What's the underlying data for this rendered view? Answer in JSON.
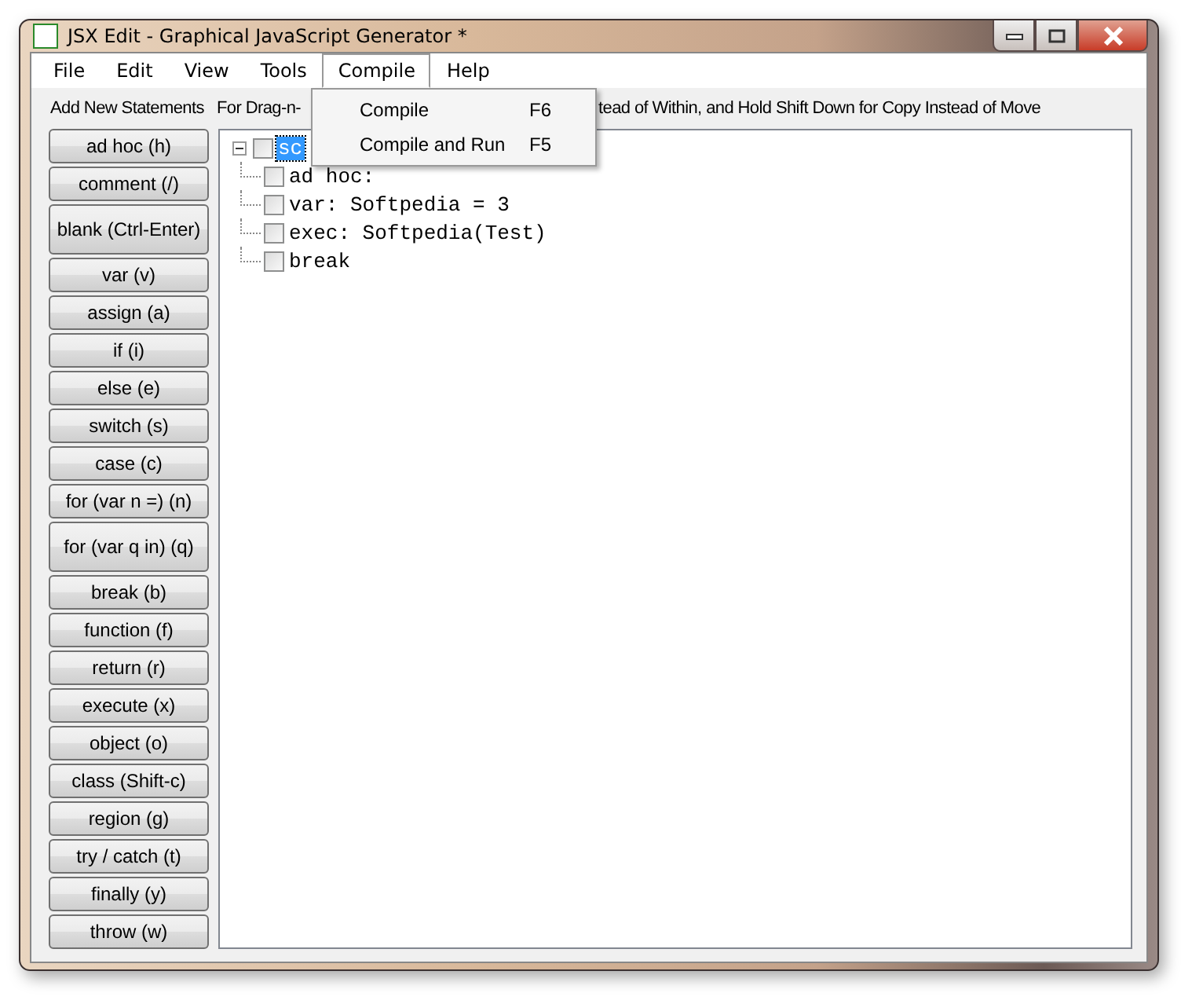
{
  "window": {
    "title": "JSX Edit - Graphical JavaScript Generator *"
  },
  "menu": [
    {
      "label": "File",
      "selected": false
    },
    {
      "label": "Edit",
      "selected": false
    },
    {
      "label": "View",
      "selected": false
    },
    {
      "label": "Tools",
      "selected": false
    },
    {
      "label": "Compile",
      "selected": true
    },
    {
      "label": "Help",
      "selected": false
    }
  ],
  "dropdown": [
    {
      "label": "Compile",
      "shortcut": "F6"
    },
    {
      "label": "Compile and Run",
      "shortcut": "F5"
    }
  ],
  "sidebar": {
    "title": "Add New Statements",
    "buttons": [
      {
        "label": "ad hoc (h)",
        "kind": "normal"
      },
      {
        "label": "comment (/)",
        "kind": "normal"
      },
      {
        "label": "blank (Ctrl-Enter)",
        "kind": "tall"
      },
      {
        "label": "var (v)",
        "kind": "normal"
      },
      {
        "label": "assign (a)",
        "kind": "normal"
      },
      {
        "label": "if (i)",
        "kind": "normal"
      },
      {
        "label": "else (e)",
        "kind": "normal"
      },
      {
        "label": "switch (s)",
        "kind": "normal"
      },
      {
        "label": "case (c)",
        "kind": "normal"
      },
      {
        "label": "for (var n =) (n)",
        "kind": "normal"
      },
      {
        "label": "for (var q in) (q)",
        "kind": "tall"
      },
      {
        "label": "break (b)",
        "kind": "normal"
      },
      {
        "label": "function (f)",
        "kind": "normal"
      },
      {
        "label": "return (r)",
        "kind": "normal"
      },
      {
        "label": "execute (x)",
        "kind": "normal"
      },
      {
        "label": "object (o)",
        "kind": "normal"
      },
      {
        "label": "class (Shift-c)",
        "kind": "normal"
      },
      {
        "label": "region (g)",
        "kind": "normal"
      },
      {
        "label": "try / catch (t)",
        "kind": "normal"
      },
      {
        "label": "finally (y)",
        "kind": "normal"
      },
      {
        "label": "throw (w)",
        "kind": "normal"
      }
    ]
  },
  "hint": [
    "For Drag-n-",
    "tead of Within, and Hold Shift Down for Copy Instead of Move"
  ],
  "tree": [
    {
      "label": "sc",
      "checked": false,
      "selected": true,
      "expanded": true,
      "children": [
        {
          "label": "ad hoc:",
          "checked": false,
          "selected": false
        },
        {
          "label": "var: Softpedia = 3",
          "checked": false,
          "selected": false
        },
        {
          "label": "exec: Softpedia(Test)",
          "checked": false,
          "selected": false
        },
        {
          "label": "break",
          "checked": false,
          "selected": false
        }
      ]
    }
  ]
}
